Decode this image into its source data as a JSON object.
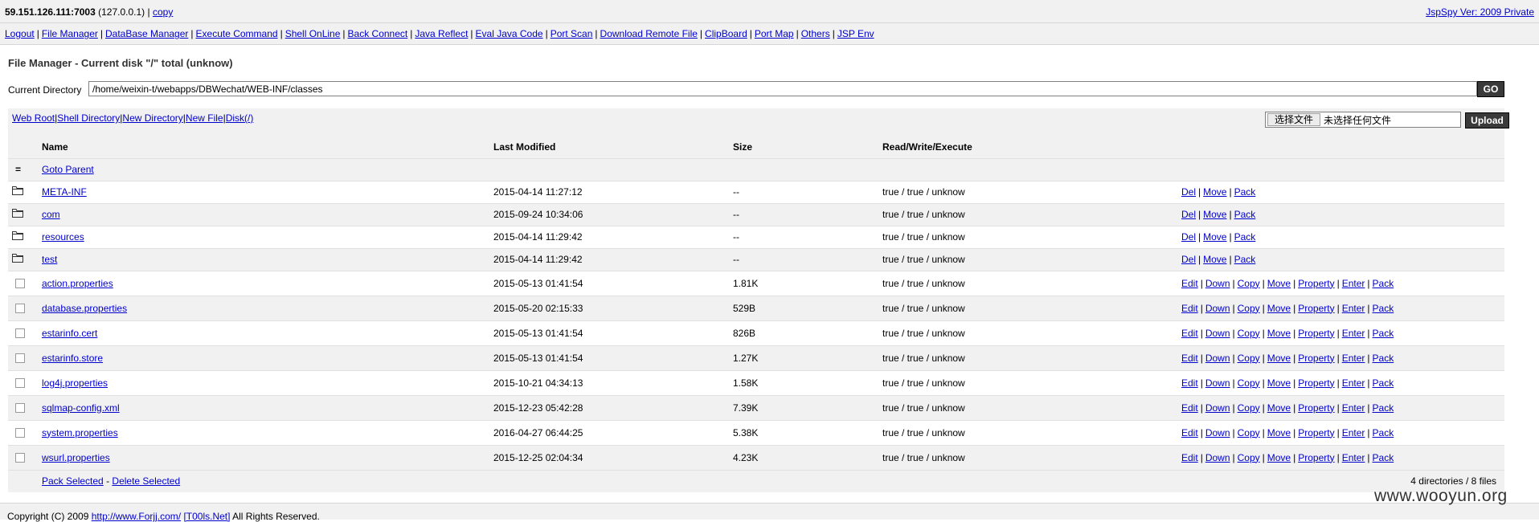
{
  "header": {
    "host": "59.151.126.111:7003",
    "local_ip": "(127.0.0.1)",
    "separator": "|",
    "copy_label": "copy",
    "version_label": "JspSpy Ver: 2009 Private"
  },
  "nav": {
    "items": [
      {
        "label": "Logout"
      },
      {
        "label": "File Manager"
      },
      {
        "label": "DataBase Manager"
      },
      {
        "label": "Execute Command"
      },
      {
        "label": "Shell OnLine"
      },
      {
        "label": "Back Connect"
      },
      {
        "label": "Java Reflect"
      },
      {
        "label": "Eval Java Code"
      },
      {
        "label": "Port Scan"
      },
      {
        "label": "Download Remote File"
      },
      {
        "label": "ClipBoard"
      },
      {
        "label": "Port Map"
      },
      {
        "label": "Others"
      },
      {
        "label": "JSP Env"
      }
    ]
  },
  "page": {
    "title": "File Manager - Current disk \"/\" total (unknow)",
    "current_dir_label": "Current Directory",
    "current_dir_value": "/home/weixin-t/webapps/DBWechat/WEB-INF/classes",
    "go_label": "GO"
  },
  "toolbar": {
    "links": [
      {
        "label": "Web Root"
      },
      {
        "label": "Shell Directory"
      },
      {
        "label": "New Directory"
      },
      {
        "label": "New File"
      },
      {
        "label": "Disk(/)"
      }
    ],
    "choose_file_label": "选择文件",
    "no_file_label": "未选择任何文件",
    "upload_label": "Upload"
  },
  "table": {
    "columns": [
      "Name",
      "Last Modified",
      "Size",
      "Read/Write/Execute"
    ],
    "goto_parent_label": "Goto Parent",
    "goto_parent_icon": "=",
    "dir_actions": [
      "Del",
      "Move",
      "Pack"
    ],
    "file_actions": [
      "Edit",
      "Down",
      "Copy",
      "Move",
      "Property",
      "Enter",
      "Pack"
    ],
    "directories": [
      {
        "name": "META-INF",
        "modified": "2015-04-14 11:27:12",
        "size": "--",
        "perm": "true / true / unknow"
      },
      {
        "name": "com",
        "modified": "2015-09-24 10:34:06",
        "size": "--",
        "perm": "true / true / unknow"
      },
      {
        "name": "resources",
        "modified": "2015-04-14 11:29:42",
        "size": "--",
        "perm": "true / true / unknow"
      },
      {
        "name": "test",
        "modified": "2015-04-14 11:29:42",
        "size": "--",
        "perm": "true / true / unknow"
      }
    ],
    "files": [
      {
        "name": "action.properties",
        "modified": "2015-05-13 01:41:54",
        "size": "1.81K",
        "perm": "true / true / unknow"
      },
      {
        "name": "database.properties",
        "modified": "2015-05-20 02:15:33",
        "size": "529B",
        "perm": "true / true / unknow"
      },
      {
        "name": "estarinfo.cert",
        "modified": "2015-05-13 01:41:54",
        "size": "826B",
        "perm": "true / true / unknow"
      },
      {
        "name": "estarinfo.store",
        "modified": "2015-05-13 01:41:54",
        "size": "1.27K",
        "perm": "true / true / unknow"
      },
      {
        "name": "log4j.properties",
        "modified": "2015-10-21 04:34:13",
        "size": "1.58K",
        "perm": "true / true / unknow"
      },
      {
        "name": "sqlmap-config.xml",
        "modified": "2015-12-23 05:42:28",
        "size": "7.39K",
        "perm": "true / true / unknow"
      },
      {
        "name": "system.properties",
        "modified": "2016-04-27 06:44:25",
        "size": "5.38K",
        "perm": "true / true / unknow"
      },
      {
        "name": "wsurl.properties",
        "modified": "2015-12-25 02:04:34",
        "size": "4.23K",
        "perm": "true / true / unknow"
      }
    ],
    "pack_selected_label": "Pack Selected",
    "dash": "-",
    "delete_selected_label": "Delete Selected",
    "summary": "4 directories / 8 files"
  },
  "footer": {
    "copyright_prefix": "Copyright (C) 2009",
    "link1": "http://www.Forjj.com/",
    "link2": "[T00ls.Net]",
    "suffix": "All Rights Reserved."
  },
  "watermark": "www.wooyun.org",
  "icons": {
    "folder": "folder-icon",
    "checkbox": "checkbox-icon"
  }
}
